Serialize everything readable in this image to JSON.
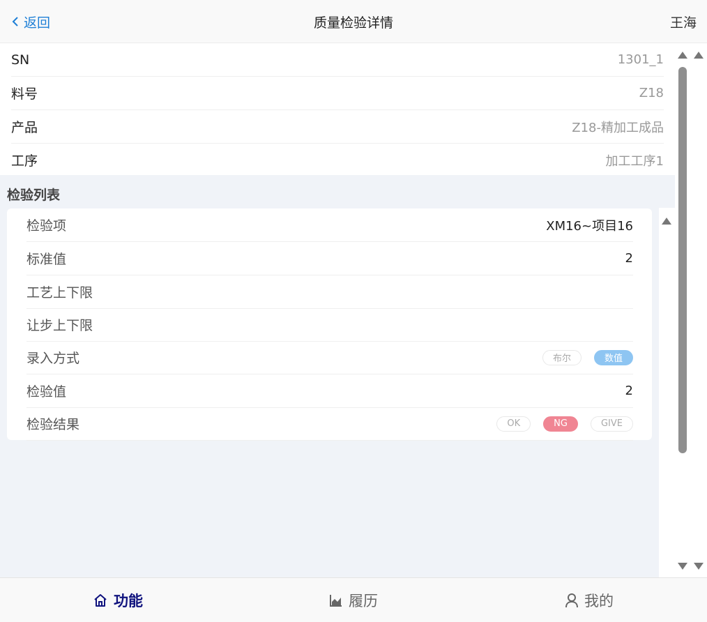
{
  "header": {
    "back_label": "返回",
    "title": "质量检验详情",
    "user": "王海"
  },
  "info": [
    {
      "label": "SN",
      "value": "1301_1"
    },
    {
      "label": "料号",
      "value": "Z18"
    },
    {
      "label": "产品",
      "value": "Z18-精加工成品"
    },
    {
      "label": "工序",
      "value": "加工工序1"
    }
  ],
  "inspection": {
    "section_title": "检验列表",
    "rows": [
      {
        "label": "检验项",
        "value": "XM16~项目16"
      },
      {
        "label": "标准值",
        "value": "2"
      },
      {
        "label": "工艺上下限",
        "value": ""
      },
      {
        "label": "让步上下限",
        "value": ""
      },
      {
        "label": "录入方式",
        "options": [
          "布尔",
          "数值"
        ],
        "selected": "数值"
      },
      {
        "label": "检验值",
        "value": "2"
      },
      {
        "label": "检验结果",
        "options": [
          "OK",
          "NG",
          "GIVE"
        ],
        "selected": "NG"
      }
    ]
  },
  "nav": [
    {
      "label": "功能",
      "icon": "home-icon",
      "active": true
    },
    {
      "label": "履历",
      "icon": "chart-icon",
      "active": false
    },
    {
      "label": "我的",
      "icon": "user-icon",
      "active": false
    }
  ],
  "colors": {
    "accent_blue": "#1e7fd6",
    "nav_active": "#10137e",
    "pill_blue": "#8ec5f2",
    "pill_red": "#f08593"
  }
}
